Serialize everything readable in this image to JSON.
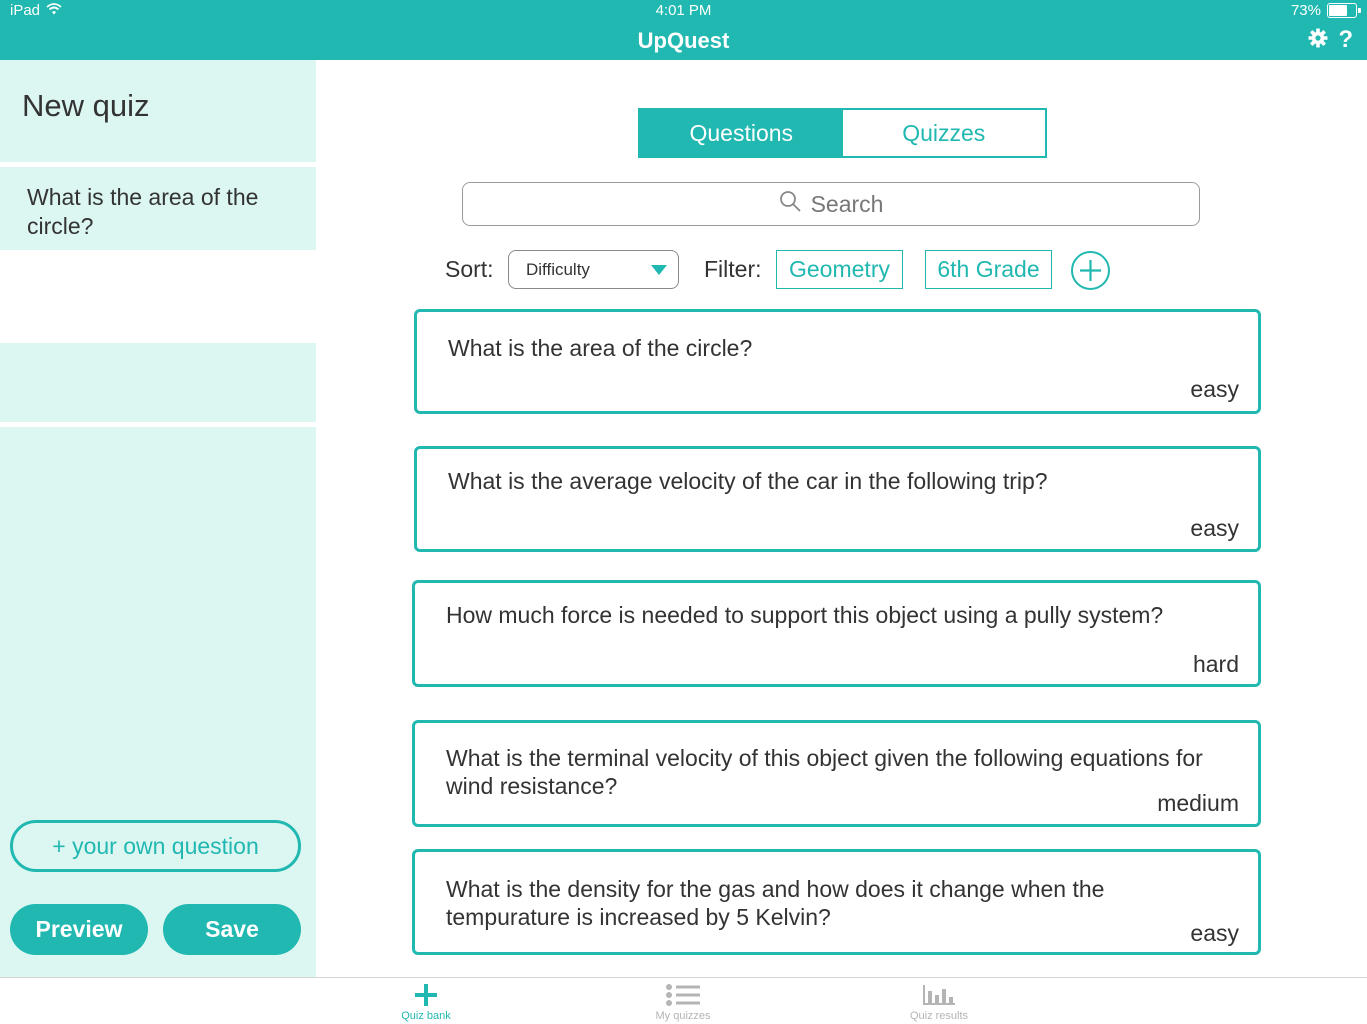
{
  "status": {
    "device": "iPad",
    "time": "4:01 PM",
    "battery": "73%",
    "battery_level": 0.73
  },
  "app": {
    "title": "UpQuest"
  },
  "sidebar": {
    "quiz_title": "New quiz",
    "questions": [
      "What is the area of the circle?"
    ],
    "add_own_label": "+ your own question",
    "preview_label": "Preview",
    "save_label": "Save"
  },
  "tabs": [
    {
      "label": "Questions",
      "active": true
    },
    {
      "label": "Quizzes",
      "active": false
    }
  ],
  "search": {
    "placeholder": "Search"
  },
  "sort": {
    "label": "Sort:",
    "value": "Difficulty"
  },
  "filter": {
    "label": "Filter:",
    "chips": [
      "Geometry",
      "6th Grade"
    ]
  },
  "questions": [
    {
      "text": "What is the area of the circle?",
      "difficulty": "easy"
    },
    {
      "text": "What is the average velocity of the car in the following trip?",
      "difficulty": "easy"
    },
    {
      "text": "How much force is needed to support this object using a pully system?",
      "difficulty": "hard"
    },
    {
      "text": "What is the terminal velocity of this object given the following equations for wind resistance?",
      "difficulty": "medium"
    },
    {
      "text": "What is the density for the gas and how does it change when the tempurature is increased by 5 Kelvin?",
      "difficulty": "easy"
    }
  ],
  "bottom_tabs": [
    {
      "label": "Quiz bank",
      "icon": "plus-icon",
      "active": true
    },
    {
      "label": "My quizzes",
      "icon": "list-icon",
      "active": false
    },
    {
      "label": "Quiz results",
      "icon": "bar-chart-icon",
      "active": false
    }
  ],
  "colors": {
    "accent": "#20b8b0",
    "sidebar_bg": "#dcf7f2",
    "inactive_tab": "#b4b4b4"
  }
}
